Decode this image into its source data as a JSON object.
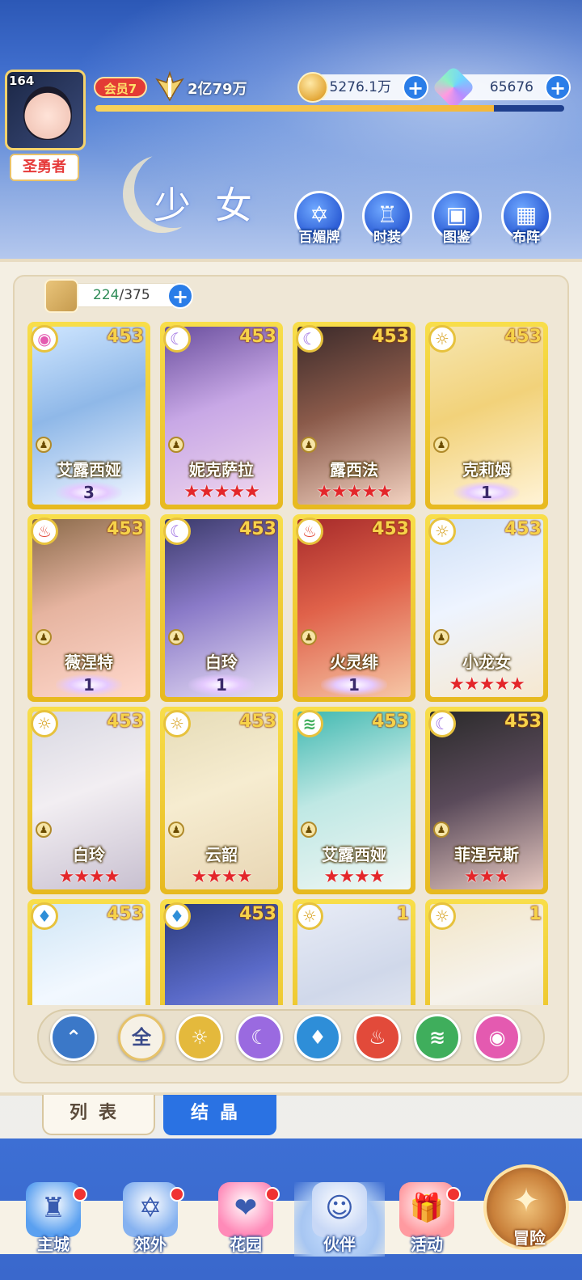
{
  "header": {
    "level": "164",
    "title_badge": "圣勇者",
    "vip": "会员7",
    "power": "2亿79万",
    "gold": "5276.1万",
    "gems": "65676",
    "exp_fraction": 0.85
  },
  "section": {
    "title": "少女",
    "buttons": [
      {
        "label": "百媚牌",
        "icon": "card-deck-icon"
      },
      {
        "label": "时装",
        "icon": "outfit-icon"
      },
      {
        "label": "图鉴",
        "icon": "book-icon"
      },
      {
        "label": "布阵",
        "icon": "grid-formation-icon"
      }
    ]
  },
  "roster": {
    "count_current": "224",
    "count_max": "375"
  },
  "cards": [
    {
      "name": "艾露西娅",
      "power": "453",
      "element": "pink",
      "rank_type": "wing",
      "rank": "3"
    },
    {
      "name": "妮克萨拉",
      "power": "453",
      "element": "moon",
      "rank_type": "stars",
      "rank": "★★★★★"
    },
    {
      "name": "露西法",
      "power": "453",
      "element": "moon",
      "rank_type": "stars",
      "rank": "★★★★★"
    },
    {
      "name": "克莉姆",
      "power": "453",
      "element": "sun",
      "rank_type": "wing",
      "rank": "1"
    },
    {
      "name": "薇涅特",
      "power": "453",
      "element": "fire",
      "rank_type": "wing",
      "rank": "1"
    },
    {
      "name": "白玲",
      "power": "453",
      "element": "moon",
      "rank_type": "wing",
      "rank": "1"
    },
    {
      "name": "火灵绯",
      "power": "453",
      "element": "fire",
      "rank_type": "wing",
      "rank": "1"
    },
    {
      "name": "小龙女",
      "power": "453",
      "element": "sun",
      "rank_type": "stars",
      "rank": "★★★★★"
    },
    {
      "name": "白玲",
      "power": "453",
      "element": "sun",
      "rank_type": "stars",
      "rank": "★★★★"
    },
    {
      "name": "云韶",
      "power": "453",
      "element": "sun",
      "rank_type": "stars",
      "rank": "★★★★"
    },
    {
      "name": "艾露西娅",
      "power": "453",
      "element": "wind",
      "rank_type": "stars",
      "rank": "★★★★"
    },
    {
      "name": "菲涅克斯",
      "power": "453",
      "element": "moon",
      "rank_type": "stars",
      "rank": "★★★"
    },
    {
      "name": "",
      "power": "453",
      "element": "water",
      "rank_type": "none",
      "rank": ""
    },
    {
      "name": "",
      "power": "453",
      "element": "water",
      "rank_type": "none",
      "rank": ""
    },
    {
      "name": "",
      "power": "1",
      "element": "sun",
      "rank_type": "none",
      "rank": ""
    },
    {
      "name": "",
      "power": "1",
      "element": "sun",
      "rank_type": "none",
      "rank": ""
    }
  ],
  "filters": [
    {
      "label": "",
      "icon": "angel-emblem-icon",
      "color": "#3b78c8"
    },
    {
      "label": "全",
      "icon": "all-filter-icon",
      "color": "#f6f1e6"
    },
    {
      "label": "",
      "icon": "sun-element-icon",
      "color": "#e4b93c"
    },
    {
      "label": "",
      "icon": "moon-element-icon",
      "color": "#9a6ae0"
    },
    {
      "label": "",
      "icon": "water-element-icon",
      "color": "#2e8ed8"
    },
    {
      "label": "",
      "icon": "fire-element-icon",
      "color": "#e24a3a"
    },
    {
      "label": "",
      "icon": "wind-element-icon",
      "color": "#3fae5c"
    },
    {
      "label": "",
      "icon": "pink-element-icon",
      "color": "#e45ab0"
    }
  ],
  "tabs": {
    "list": "列表",
    "crystal": "结晶"
  },
  "nav": [
    {
      "label": "主城",
      "icon": "castle-icon",
      "dot": true
    },
    {
      "label": "郊外",
      "icon": "portal-icon",
      "dot": true
    },
    {
      "label": "花园",
      "icon": "heart-garden-icon",
      "dot": true
    },
    {
      "label": "伙伴",
      "icon": "partner-portrait-icon",
      "dot": false
    },
    {
      "label": "活动",
      "icon": "gift-box-icon",
      "dot": true
    },
    {
      "label": "冒险",
      "icon": "compass-sword-icon",
      "dot": false
    }
  ]
}
